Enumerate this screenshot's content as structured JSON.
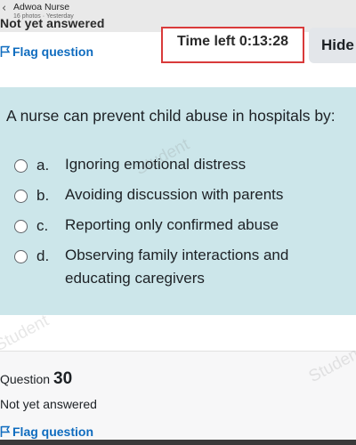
{
  "post_header": {
    "author": "Adwoa Nurse",
    "meta": "16 photos · Yesterday",
    "previous_status": "Not yet answered"
  },
  "question_header": {
    "flag_label": "Flag question",
    "timer_text": "Time left 0:13:28",
    "hide_label": "Hide"
  },
  "question": {
    "text": "A nurse can prevent child abuse in hospitals by:",
    "options": [
      {
        "letter": "a.",
        "text": "Ignoring emotional distress"
      },
      {
        "letter": "b.",
        "text": "Avoiding discussion with parents"
      },
      {
        "letter": "c.",
        "text": "Reporting only confirmed abuse"
      },
      {
        "letter": "d.",
        "text": "Observing family interactions and educating caregivers"
      }
    ]
  },
  "watermarks": [
    "Student",
    "Student",
    "Student"
  ],
  "next_question": {
    "label": "Question",
    "number": "30",
    "status": "Not yet answered",
    "flag_label": "Flag question"
  },
  "colors": {
    "link": "#0f6cbf",
    "timer_border": "#d93a3a",
    "question_bg": "#cce6ea"
  }
}
